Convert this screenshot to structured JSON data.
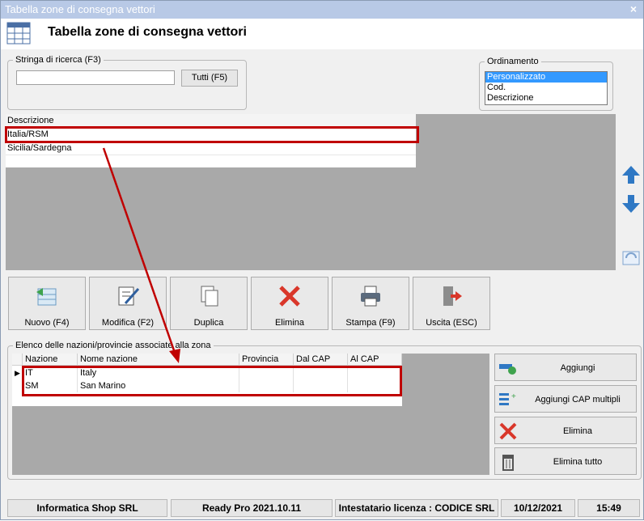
{
  "window": {
    "title": "Tabella zone di consegna vettori",
    "close_icon": "close-icon"
  },
  "header": {
    "title": "Tabella zone di consegna vettori",
    "icon": "table-grid-icon"
  },
  "search": {
    "legend": "Stringa di ricerca (F3)",
    "value": "",
    "all_button": "Tutti (F5)"
  },
  "sort": {
    "legend": "Ordinamento",
    "options": [
      "Personalizzato",
      "Cod.",
      "Descrizione"
    ],
    "selected": "Personalizzato"
  },
  "zones": {
    "header": "Descrizione",
    "rows": [
      "Italia/RSM",
      "Sicilia/Sardegna"
    ]
  },
  "toolbar": {
    "new": "Nuovo (F4)",
    "edit": "Modifica (F2)",
    "duplicate": "Duplica",
    "delete": "Elimina",
    "print": "Stampa (F9)",
    "exit": "Uscita (ESC)"
  },
  "nations": {
    "legend": "Elenco delle nazioni/provincie associate alla zona",
    "columns": [
      "Nazione",
      "Nome nazione",
      "Provincia",
      "Dal CAP",
      "Al CAP"
    ],
    "rows": [
      [
        "IT",
        "Italy",
        "",
        "",
        ""
      ],
      [
        "SM",
        "San Marino",
        "",
        "",
        ""
      ]
    ]
  },
  "side_actions": {
    "add": "Aggiungi",
    "add_cap": "Aggiungi CAP multipli",
    "delete": "Elimina",
    "delete_all": "Elimina tutto"
  },
  "status": {
    "company": "Informatica Shop SRL",
    "version": "Ready Pro 2021.10.11",
    "license": "Intestatario licenza : CODICE SRL",
    "date": "10/12/2021",
    "time": "15:49"
  },
  "colors": {
    "accent_selection": "#3399ff",
    "highlight_box": "#c00000",
    "titlebar": "#b8c9e6"
  }
}
